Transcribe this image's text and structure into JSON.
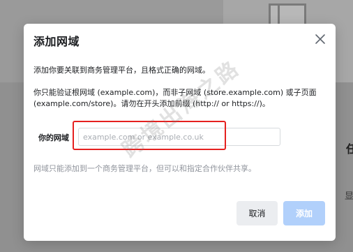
{
  "background": {
    "side_text_1": "任何",
    "side_text_2": "显示"
  },
  "dialog": {
    "title": "添加网域",
    "description_1": "添加你要关联到商务管理平台，且格式正确的网域。",
    "description_2": "你只能验证根网域 (example.com)，而非子网域 (store.example.com) 或子页面 (example.com/store)。请勿在开头添加前缀 (http:// or https://)。",
    "field_label": "你的网域",
    "field_value": "",
    "field_placeholder": "example.com or example.co.uk",
    "hint": "网域只能添加到一个商务管理平台，但可以和指定合作伙伴共享。",
    "cancel_label": "取消",
    "add_label": "添加",
    "close_icon": "close-icon"
  },
  "watermark": "跨境出海之路",
  "colors": {
    "highlight": "#e5201f",
    "add_button_disabled": "#b1d0fb",
    "cancel_button": "#ebedf0",
    "hint_text": "#90949c"
  }
}
